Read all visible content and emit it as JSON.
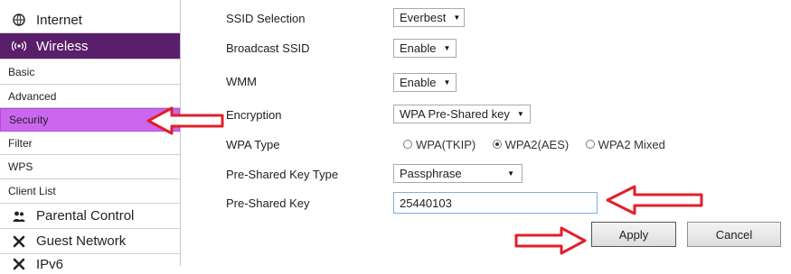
{
  "sidebar": {
    "items": [
      {
        "label": "Internet",
        "icon": "globe-icon"
      },
      {
        "label": "Wireless",
        "icon": "wifi-icon"
      },
      {
        "label": "Basic"
      },
      {
        "label": "Advanced"
      },
      {
        "label": "Security"
      },
      {
        "label": "Filter"
      },
      {
        "label": "WPS"
      },
      {
        "label": "Client List"
      },
      {
        "label": "Parental Control",
        "icon": "users-icon"
      },
      {
        "label": "Guest Network",
        "icon": "tools-icon"
      },
      {
        "label": "IPv6",
        "icon": "tools-icon"
      }
    ]
  },
  "form": {
    "ssid_selection": {
      "label": "SSID Selection",
      "value": "Everbest"
    },
    "broadcast_ssid": {
      "label": "Broadcast SSID",
      "value": "Enable"
    },
    "wmm": {
      "label": "WMM",
      "value": "Enable"
    },
    "encryption": {
      "label": "Encryption",
      "value": "WPA Pre-Shared key"
    },
    "wpa_type": {
      "label": "WPA Type",
      "options": [
        "WPA(TKIP)",
        "WPA2(AES)",
        "WPA2 Mixed"
      ],
      "selected": "WPA2(AES)"
    },
    "psk_type": {
      "label": "Pre-Shared Key Type",
      "value": "Passphrase"
    },
    "psk": {
      "label": "Pre-Shared Key",
      "value": "25440103"
    }
  },
  "buttons": {
    "apply": "Apply",
    "cancel": "Cancel"
  },
  "colors": {
    "wireless_bg": "#5a1f6a",
    "security_bg": "#cc66ee",
    "arrow": "#e0202a"
  }
}
